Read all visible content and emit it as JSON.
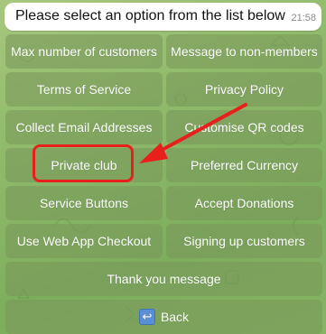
{
  "message": {
    "text": "Please select an option from the list below",
    "time": "21:58"
  },
  "keyboard": {
    "rows": [
      [
        "Max number of customers",
        "Message to non-members"
      ],
      [
        "Terms of Service",
        "Privacy Policy"
      ],
      [
        "Collect Email Addresses",
        "Customise QR codes"
      ],
      [
        "Private club",
        "Preferred Currency"
      ],
      [
        "Service Buttons",
        "Accept Donations"
      ],
      [
        "Use Web App Checkout",
        "Signing up customers"
      ],
      [
        "Thank you message"
      ]
    ],
    "back": {
      "icon": "back-arrow-icon",
      "label": "Back"
    }
  },
  "annotation": {
    "highlight_color": "#e8201c",
    "highlighted_button": "Private club"
  }
}
